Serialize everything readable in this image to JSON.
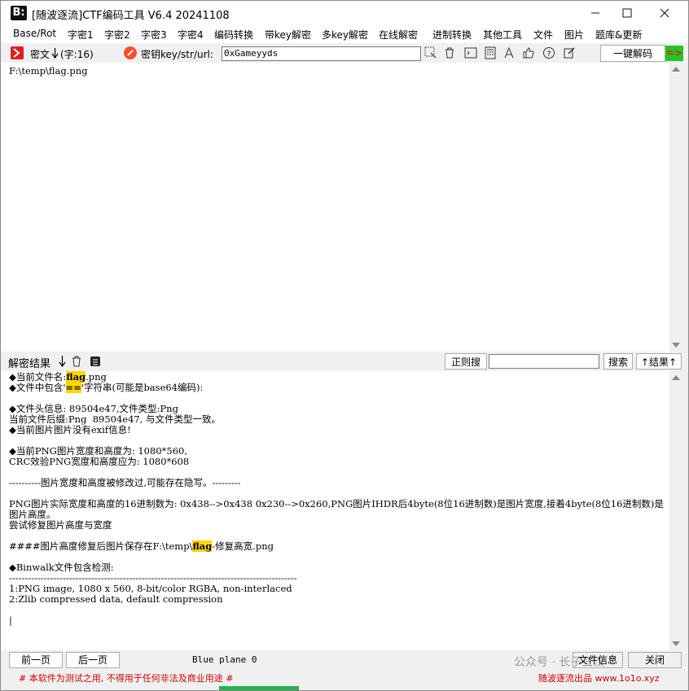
{
  "window": {
    "title": "[随波逐流]CTF编码工具 V6.4 20241108",
    "icon_label": "B:",
    "controls": [
      "minimize-icon",
      "maximize-icon",
      "close-icon"
    ]
  },
  "menu": {
    "items": [
      "Base/Rot",
      "字密1",
      "字密2",
      "字密3",
      "字密4",
      "编码转换",
      "带key解密",
      "多key解密",
      "在线解密",
      "进制转换",
      "其他工具",
      "文件",
      "图片",
      "题库&更新"
    ]
  },
  "toolbar": {
    "ciphertext_label": "密文",
    "char_count": "(字:16)",
    "key_label": "密钥key/str/url:",
    "key_value": "0xGameyyds",
    "decode_all_button": "一键解码",
    "arrow_label": "=>"
  },
  "input": {
    "text": "F:\\temp\\flag.png"
  },
  "result_bar": {
    "label": "解密结果",
    "regex_button": "正则搜",
    "regex_value": "",
    "search_button": "搜索",
    "result_up_button": "结果"
  },
  "output": {
    "lines": [
      [
        {
          "t": "◆当前文件名:"
        },
        {
          "t": "flag",
          "hl": true
        },
        {
          "t": ".png"
        }
      ],
      [
        {
          "t": "◆文件中包含'"
        },
        {
          "t": "==",
          "hl": true
        },
        {
          "t": "'字符串(可能是base64编码):"
        }
      ],
      [
        {
          "t": ""
        }
      ],
      [
        {
          "t": "◆文件头信息: 89504e47,文件类型:Png"
        }
      ],
      [
        {
          "t": "当前文件后缀:Png  89504e47, 与文件类型一致。"
        }
      ],
      [
        {
          "t": "◆当前图片图片没有exif信息!"
        }
      ],
      [
        {
          "t": ""
        }
      ],
      [
        {
          "t": "◆当前PNG图片宽度和高度为: 1080*560,"
        }
      ],
      [
        {
          "t": "CRC效验PNG宽度和高度应为: 1080*608"
        }
      ],
      [
        {
          "t": ""
        }
      ],
      [
        {
          "t": "----------图片宽度和高度被修改过,可能存在隐写。---------"
        }
      ],
      [
        {
          "t": ""
        }
      ],
      [
        {
          "t": "PNG图片实际宽度和高度的16进制数为: 0x438-->0x438 0x230-->0x260,PNG图片IHDR后4byte(8位16进制数)是图片宽度,接着4byte(8位16进制数)是图片高度。"
        }
      ],
      [
        {
          "t": "尝试修复图片高度与宽度"
        }
      ],
      [
        {
          "t": ""
        }
      ],
      [
        {
          "t": "####图片高度修复后图片保存在F:\\temp\\"
        },
        {
          "t": "flag",
          "hl": true
        },
        {
          "t": "-修复高宽.png"
        }
      ],
      [
        {
          "t": ""
        }
      ],
      [
        {
          "t": "◆Binwalk文件包含检测:"
        }
      ],
      [
        {
          "t": "-------------------------------------------------------------------------------------------"
        }
      ],
      [
        {
          "t": "1:PNG image, 1080 x 560, 8-bit/color RGBA, non-interlaced"
        }
      ],
      [
        {
          "t": "2:Zlib compressed data, default compression"
        }
      ],
      [
        {
          "t": ""
        }
      ],
      [
        {
          "t": "|"
        }
      ]
    ]
  },
  "bottom": {
    "prev_page": "前一页",
    "next_page": "后一页",
    "plane_status": "Blue plane 0",
    "watermark": "公众号 · 长子三汉",
    "file_info": "文件信息",
    "close": "关闭"
  },
  "status": {
    "left_text": "# 本软件为测试之用, 不得用于任何非法及商业用途 #",
    "right_text": "随波逐流出品 www.1o1o.xyz"
  },
  "colors": {
    "highlight": "#ffd700",
    "status_text": "#d00000",
    "accent_green": "#22c722",
    "accent_red": "#e02020"
  }
}
